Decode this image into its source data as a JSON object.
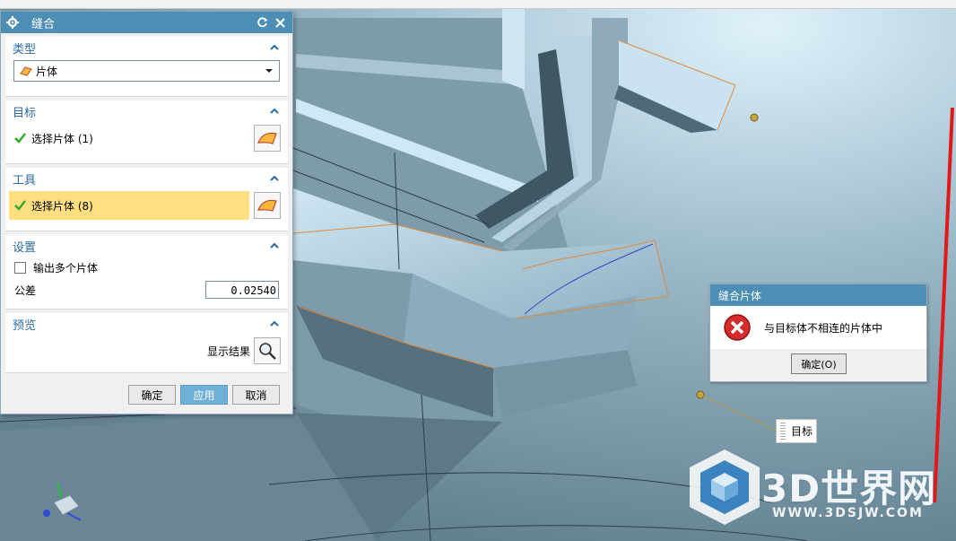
{
  "dialog": {
    "title": "缝合",
    "icons": {
      "settings": "gear-icon",
      "reset": "reset-icon",
      "close": "close-icon"
    },
    "type_section": {
      "label": "类型",
      "value": "片体"
    },
    "target_section": {
      "label": "目标",
      "select_text": "选择片体 (1)"
    },
    "tool_section": {
      "label": "工具",
      "select_text": "选择片体 (8)"
    },
    "settings_section": {
      "label": "设置",
      "output_multiple_label": "输出多个片体",
      "tolerance_label": "公差",
      "tolerance_value": "0.02540"
    },
    "preview_section": {
      "label": "预览",
      "show_result_label": "显示结果"
    },
    "buttons": {
      "ok": "确定",
      "apply": "应用",
      "cancel": "取消"
    }
  },
  "message_box": {
    "title": "缝合片体",
    "message": "与目标体不相连的片体中",
    "ok_label": "确定(O)"
  },
  "target_label": "目标",
  "watermark": {
    "text": "3D世界网",
    "url": "WWW.3DSJW.COM"
  },
  "colors": {
    "title_bar": "#4d8fb4",
    "section_header": "#2a6aa0",
    "highlight": "#ffdf80",
    "apply_button": "#6fb0d8"
  }
}
